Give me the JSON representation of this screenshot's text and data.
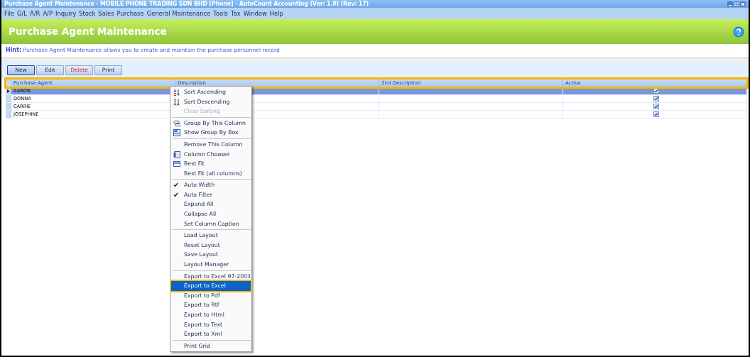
{
  "window": {
    "title": "Purchase Agent Maintenance - MOBILE PHONE TRADING SDN BHD [Phone] - AutoCount Accounting (Ver: 1.9) (Rev: 17)"
  },
  "menu_bar": [
    "File",
    "G/L",
    "A/R",
    "A/P",
    "Inquiry",
    "Stock",
    "Sales",
    "Purchase",
    "General Maintenance",
    "Tools",
    "Tax",
    "Window",
    "Help"
  ],
  "header": {
    "title": "Purchase Agent Maintenance"
  },
  "hint": {
    "label": "Hint:",
    "text": "Purchase Agent Maintenance allows you to create and maintain the purchase personnel record"
  },
  "toolbar": [
    {
      "label": "New",
      "kind": "default",
      "selected": true
    },
    {
      "label": "Edit",
      "kind": "default",
      "selected": false
    },
    {
      "label": "Delete",
      "kind": "danger",
      "selected": false
    },
    {
      "label": "Print",
      "kind": "default",
      "selected": false
    }
  ],
  "grid": {
    "columns": [
      "Purchase Agent",
      "Description",
      "2nd Description",
      "Active"
    ],
    "rows": [
      {
        "name": "AARON",
        "selected": true,
        "active": true
      },
      {
        "name": "DONNA",
        "selected": false,
        "active": true
      },
      {
        "name": "CARRIE",
        "selected": false,
        "active": true
      },
      {
        "name": "JOSEPHINE",
        "selected": false,
        "active": true
      }
    ]
  },
  "context_menu": [
    [
      {
        "label": "Sort Ascending",
        "kind": "sort_ascending",
        "checked": false,
        "disabled": false,
        "selected": false
      },
      {
        "label": "Sort Descending",
        "kind": "sort_descending",
        "checked": false,
        "disabled": false,
        "selected": false
      },
      {
        "label": "Clear Sorting",
        "checked": false,
        "disabled": true,
        "selected": false
      }
    ],
    [
      {
        "label": "Group By This Column",
        "kind": "group",
        "checked": false,
        "disabled": false,
        "selected": false
      },
      {
        "label": "Show Group By Box",
        "kind": "group_box",
        "checked": false,
        "disabled": false,
        "selected": false
      }
    ],
    [
      {
        "label": "Remove This Column",
        "checked": false,
        "disabled": false,
        "selected": false
      },
      {
        "label": "Column Chooser",
        "kind": "column_chooser",
        "checked": false,
        "disabled": false,
        "selected": false
      },
      {
        "label": "Best Fit",
        "kind": "best_fit",
        "checked": false,
        "disabled": false,
        "selected": false
      },
      {
        "label": "Best Fit (all columns)",
        "checked": false,
        "disabled": false,
        "selected": false
      }
    ],
    [
      {
        "label": "Auto Width",
        "checked": true,
        "disabled": false,
        "selected": false
      },
      {
        "label": "Auto Filter",
        "checked": true,
        "disabled": false,
        "selected": false
      },
      {
        "label": "Expand All",
        "checked": false,
        "disabled": false,
        "selected": false
      },
      {
        "label": "Collapse All",
        "checked": false,
        "disabled": false,
        "selected": false
      },
      {
        "label": "Set Column Caption",
        "checked": false,
        "disabled": false,
        "selected": false
      }
    ],
    [
      {
        "label": "Load Layout",
        "checked": false,
        "disabled": false,
        "selected": false
      },
      {
        "label": "Reset Layout",
        "checked": false,
        "disabled": false,
        "selected": false
      },
      {
        "label": "Save Layout",
        "checked": false,
        "disabled": false,
        "selected": false
      },
      {
        "label": "Layout Manager",
        "checked": false,
        "disabled": false,
        "selected": false
      }
    ],
    [
      {
        "label": "Export to Excel 97-2003",
        "checked": false,
        "disabled": false,
        "selected": false
      },
      {
        "label": "Export to Excel",
        "checked": false,
        "disabled": false,
        "selected": true
      },
      {
        "label": "Export to Pdf",
        "checked": false,
        "disabled": false,
        "selected": false
      },
      {
        "label": "Export to Rtf",
        "checked": false,
        "disabled": false,
        "selected": false
      },
      {
        "label": "Export to Html",
        "checked": false,
        "disabled": false,
        "selected": false
      },
      {
        "label": "Export to Text",
        "checked": false,
        "disabled": false,
        "selected": false
      },
      {
        "label": "Export to Xml",
        "checked": false,
        "disabled": false,
        "selected": false
      }
    ],
    [
      {
        "label": "Print Grid",
        "checked": false,
        "disabled": false,
        "selected": false
      }
    ]
  ]
}
